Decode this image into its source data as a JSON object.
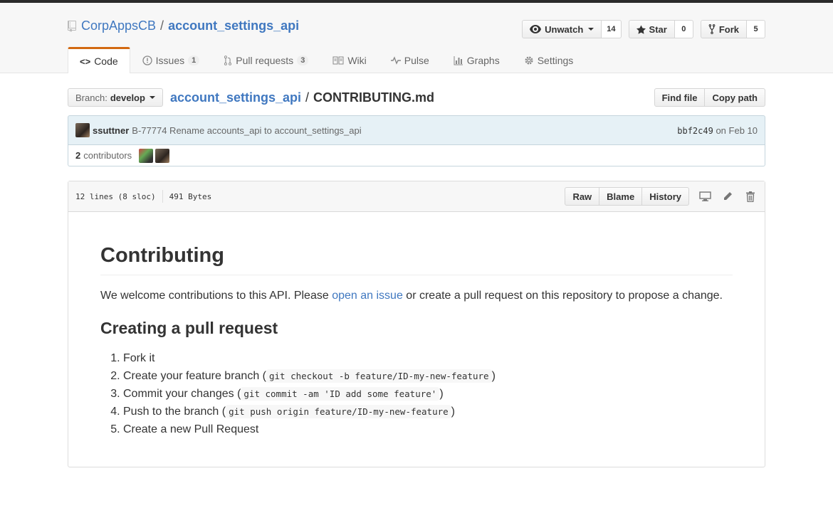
{
  "repo": {
    "owner": "CorpAppsCB",
    "name": "account_settings_api"
  },
  "actions": {
    "watch_label": "Unwatch",
    "watch_count": "14",
    "star_label": "Star",
    "star_count": "0",
    "fork_label": "Fork",
    "fork_count": "5"
  },
  "nav": {
    "code": "Code",
    "issues": "Issues",
    "issues_count": "1",
    "pulls": "Pull requests",
    "pulls_count": "3",
    "wiki": "Wiki",
    "pulse": "Pulse",
    "graphs": "Graphs",
    "settings": "Settings"
  },
  "file_nav": {
    "branch_label": "Branch:",
    "branch_value": "develop",
    "breadcrumb_repo": "account_settings_api",
    "breadcrumb_sep": "/",
    "breadcrumb_file": "CONTRIBUTING.md",
    "find_file": "Find file",
    "copy_path": "Copy path"
  },
  "commit": {
    "author": "ssuttner",
    "message": "B-77774 Rename accounts_api to account_settings_api",
    "sha": "bbf2c49",
    "date": "on Feb 10"
  },
  "contributors": {
    "count": "2",
    "label": "contributors"
  },
  "file_header": {
    "lines": "12 lines (8 sloc)",
    "size": "491 Bytes",
    "raw": "Raw",
    "blame": "Blame",
    "history": "History"
  },
  "content": {
    "h1": "Contributing",
    "p_before": "We welcome contributions to this API. Please ",
    "p_link": "open an issue",
    "p_after": " or create a pull request on this repository to propose a change.",
    "h2": "Creating a pull request",
    "steps": [
      {
        "text": "Fork it",
        "code": ""
      },
      {
        "text": "Create your feature branch (",
        "code": "git checkout -b feature/ID-my-new-feature",
        "after": ")"
      },
      {
        "text": "Commit your changes (",
        "code": "git commit -am 'ID add some feature'",
        "after": ")"
      },
      {
        "text": "Push to the branch (",
        "code": "git push origin feature/ID-my-new-feature",
        "after": ")"
      },
      {
        "text": "Create a new Pull Request",
        "code": ""
      }
    ]
  },
  "colors": {
    "link": "#4078c0",
    "tab_accent": "#d26911",
    "commit_bg": "#e6f1f6"
  }
}
